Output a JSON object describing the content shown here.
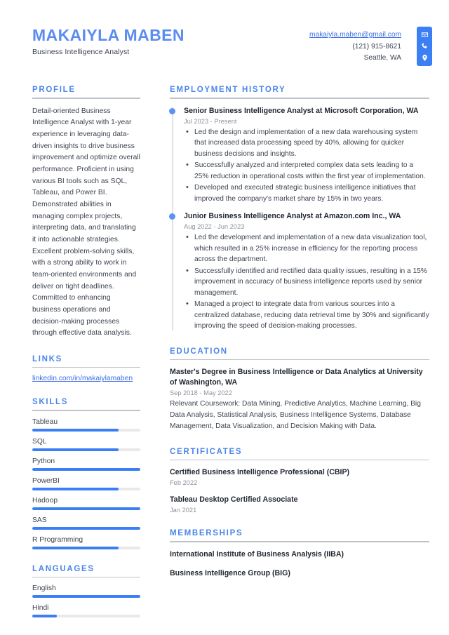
{
  "header": {
    "name": "MAKAIYLA MABEN",
    "job_title": "Business Intelligence Analyst",
    "email": "makaiyla.maben@gmail.com",
    "phone": "(121) 915-8621",
    "location": "Seattle, WA",
    "icons": [
      "envelope-icon",
      "phone-icon",
      "location-pin-icon"
    ],
    "accent_color": "#3b7ff5",
    "heading_color": "#4a86ea"
  },
  "profile": {
    "heading": "PROFILE",
    "text": "Detail-oriented Business Intelligence Analyst with 1-year experience in leveraging data-driven insights to drive business improvement and optimize overall performance. Proficient in using various BI tools such as SQL, Tableau, and Power BI. Demonstrated abilities in managing complex projects, interpreting data, and translating it into actionable strategies. Excellent problem-solving skills, with a strong ability to work in team-oriented environments and deliver on tight deadlines. Committed to enhancing business operations and decision-making processes through effective data analysis."
  },
  "links": {
    "heading": "LINKS",
    "items": [
      {
        "label": "linkedin.com/in/makaiylamaben"
      }
    ]
  },
  "skills": {
    "heading": "SKILLS",
    "items": [
      {
        "name": "Tableau",
        "level": 80
      },
      {
        "name": "SQL",
        "level": 80
      },
      {
        "name": "Python",
        "level": 100
      },
      {
        "name": "PowerBI",
        "level": 80
      },
      {
        "name": "Hadoop",
        "level": 100
      },
      {
        "name": "SAS",
        "level": 100
      },
      {
        "name": "R Programming",
        "level": 80
      }
    ]
  },
  "languages": {
    "heading": "LANGUAGES",
    "items": [
      {
        "name": "English",
        "level": 100
      },
      {
        "name": "Hindi",
        "level": 23
      }
    ]
  },
  "employment": {
    "heading": "EMPLOYMENT HISTORY",
    "jobs": [
      {
        "title": "Senior Business Intelligence Analyst at Microsoft Corporation, WA",
        "date": "Jul 2023 - Present",
        "bullets": [
          "Led the design and implementation of a new data warehousing system that increased data processing speed by 40%, allowing for quicker business decisions and insights.",
          "Successfully analyzed and interpreted complex data sets leading to a 25% reduction in operational costs within the first year of implementation.",
          "Developed and executed strategic business intelligence initiatives that improved the company's market share by 15% in two years."
        ]
      },
      {
        "title": "Junior Business Intelligence Analyst at Amazon.com Inc., WA",
        "date": "Aug 2022 - Jun 2023",
        "bullets": [
          "Led the development and implementation of a new data visualization tool, which resulted in a 25% increase in efficiency for the reporting process across the department.",
          "Successfully identified and rectified data quality issues, resulting in a 15% improvement in accuracy of business intelligence reports used by senior management.",
          "Managed a project to integrate data from various sources into a centralized database, reducing data retrieval time by 30% and significantly improving the speed of decision-making processes."
        ]
      }
    ]
  },
  "education": {
    "heading": "EDUCATION",
    "items": [
      {
        "title": "Master's Degree in Business Intelligence or Data Analytics at University of Washington, WA",
        "date": "Sep 2018 - May 2022",
        "body": "Relevant Coursework: Data Mining, Predictive Analytics, Machine Learning, Big Data Analysis, Statistical Analysis, Business Intelligence Systems, Database Management, Data Visualization, and Decision Making with Data."
      }
    ]
  },
  "certificates": {
    "heading": "CERTIFICATES",
    "items": [
      {
        "title": "Certified Business Intelligence Professional (CBIP)",
        "date": "Feb 2022"
      },
      {
        "title": "Tableau Desktop Certified Associate",
        "date": "Jan 2021"
      }
    ]
  },
  "memberships": {
    "heading": "MEMBERSHIPS",
    "items": [
      {
        "title": "International Institute of Business Analysis (IIBA)"
      },
      {
        "title": "Business Intelligence Group (BIG)"
      }
    ]
  }
}
